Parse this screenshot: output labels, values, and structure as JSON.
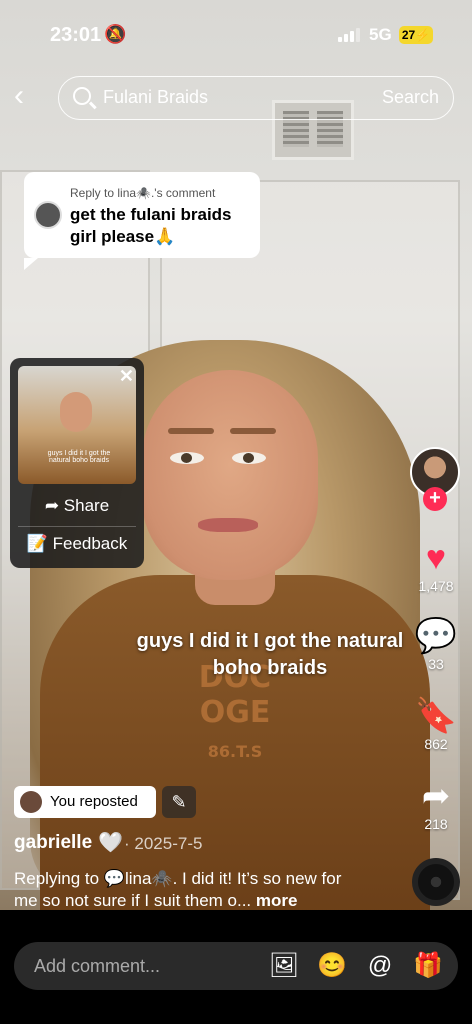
{
  "status_bar": {
    "time": "23:01",
    "network": "5G",
    "battery": "27"
  },
  "search": {
    "value": "Fulani Braids",
    "button": "Search"
  },
  "reply_bubble": {
    "header": "Reply to lina🕷️.'s comment",
    "text": "get the fulani braids girl please🙏"
  },
  "popup": {
    "thumb_caption": "guys I did it I got the natural boho braids",
    "share_label": "Share",
    "feedback_label": "Feedback"
  },
  "rail": {
    "likes": "1,478",
    "comments": "33",
    "saves": "862",
    "shares": "218"
  },
  "caption": "guys I did it I got the natural boho braids",
  "shirt_text": "DOC\nOGE\n86.T.S",
  "repost": {
    "label": "You reposted"
  },
  "post": {
    "author": "gabrielle",
    "date": "· 2025-7-5",
    "description": "Replying to 💬lina🕷️. I did it! It’s so new for me so not sure if I suit them o...",
    "more": "more"
  },
  "comment": {
    "placeholder": "Add comment..."
  },
  "colors": {
    "like_red": "#fe2c55",
    "battery_yellow": "#f4d72c"
  },
  "icons": [
    "back-icon",
    "search-icon",
    "close-icon",
    "share-arrow-icon",
    "feedback-icon",
    "heart-icon",
    "comment-icon",
    "bookmark-icon",
    "share-icon",
    "edit-icon",
    "image-icon",
    "emoji-icon",
    "mention-icon",
    "gift-icon"
  ]
}
